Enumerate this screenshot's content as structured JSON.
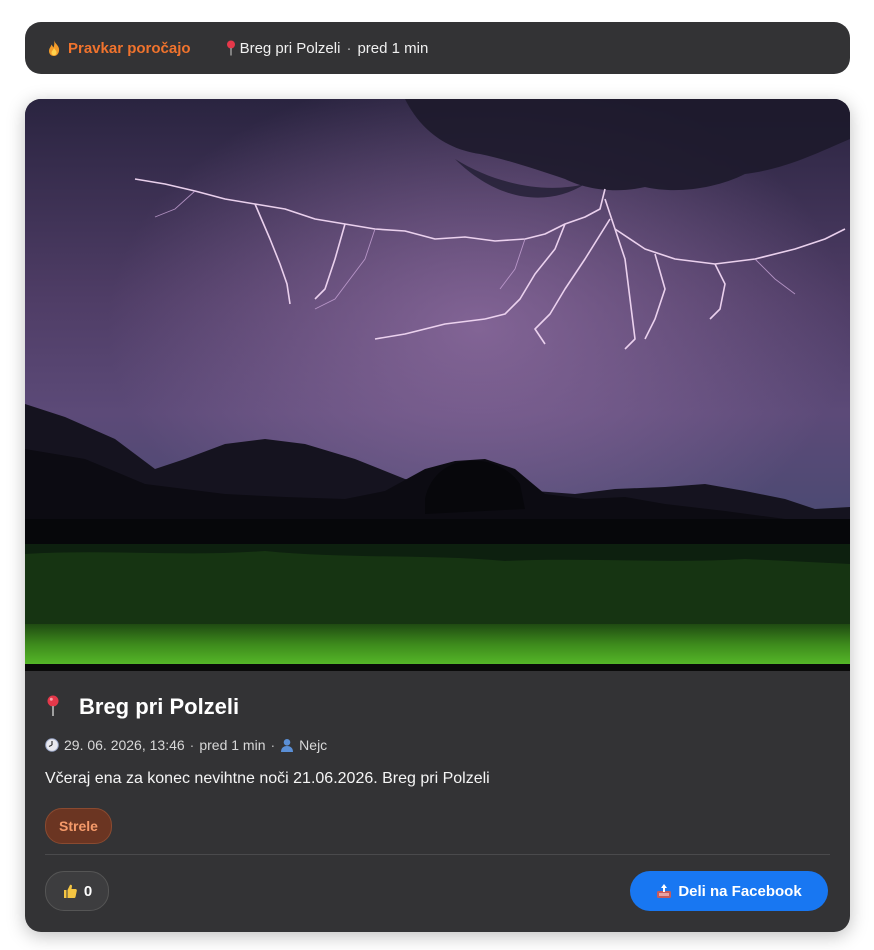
{
  "ticker": {
    "live_label": "Pravkar poročajo",
    "location": "Breg pri Polzeli",
    "separator": "·",
    "time_ago": "pred 1 min"
  },
  "report": {
    "title": "Breg pri Polzeli",
    "date": "29. 06. 2026, 13:46",
    "time_ago": "pred 1 min",
    "author": "Nejc",
    "separator": "·",
    "description": "Včeraj ena za konec nevihtne noči 21.06.2026. Breg pri Polzeli",
    "tag": "Strele",
    "likes": "0",
    "share_label": "Deli na Facebook"
  },
  "icons": {
    "live": "fire-icon",
    "pin": "map-pin-icon",
    "clock": "clock-icon",
    "user": "user-icon",
    "like": "thumbs-up-icon",
    "share": "share-icon"
  },
  "colors": {
    "accent": "#f0732d",
    "card_bg": "#333335",
    "facebook": "#1877f2",
    "tag_bg": "#6b3522"
  }
}
